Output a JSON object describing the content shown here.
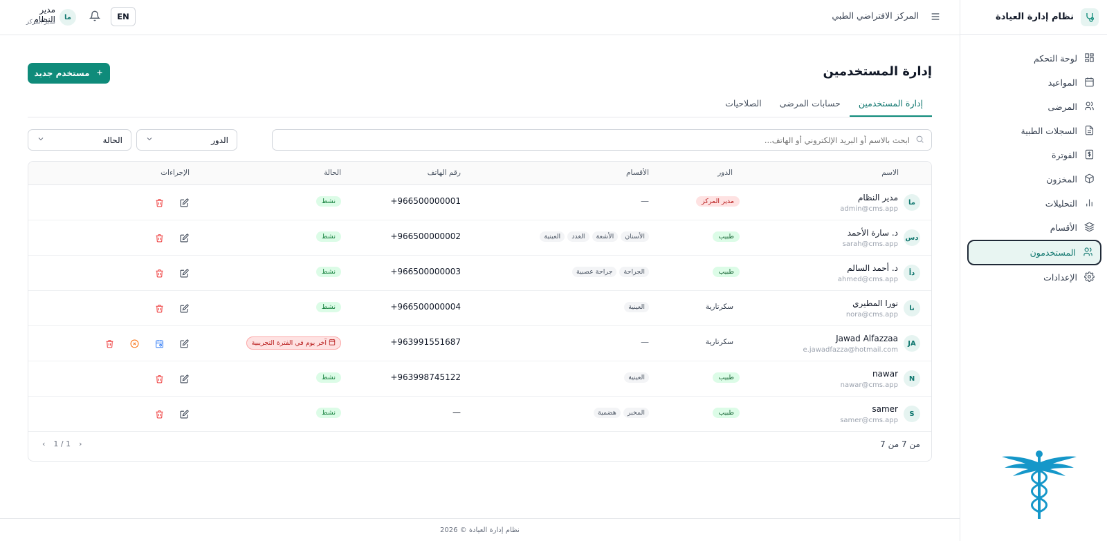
{
  "app": {
    "title": "نظام إدارة العيادة",
    "center_name": "المركز الافتراضي الطبي",
    "lang_button": "EN",
    "user": {
      "initials": "ما",
      "name": "مدير النظام",
      "role": "مدير المركز"
    },
    "footer": "نظام إدارة العيادة © 2026"
  },
  "sidebar": {
    "items": [
      {
        "label": "لوحة التحكم",
        "icon": "dashboard-icon"
      },
      {
        "label": "المواعيد",
        "icon": "calendar-icon"
      },
      {
        "label": "المرضى",
        "icon": "patients-icon"
      },
      {
        "label": "السجلات الطبية",
        "icon": "document-icon"
      },
      {
        "label": "الفوترة",
        "icon": "invoice-icon"
      },
      {
        "label": "المخزون",
        "icon": "box-icon"
      },
      {
        "label": "التحليلات",
        "icon": "chart-icon"
      },
      {
        "label": "الأقسام",
        "icon": "layers-icon"
      },
      {
        "label": "المستخدمون",
        "icon": "users-icon",
        "active": true
      },
      {
        "label": "الإعدادات",
        "icon": "gear-icon"
      }
    ]
  },
  "page": {
    "title": "إدارة المستخدمين",
    "new_button": "مستخدم جديد",
    "tabs": [
      "إدارة المستخدمين",
      "حسابات المرضى",
      "الصلاحيات"
    ],
    "search_placeholder": "ابحث بالاسم أو البريد الإلكتروني أو الهاتف...",
    "role_filter": "الدور",
    "status_filter": "الحالة"
  },
  "table": {
    "headers": {
      "name": "الاسم",
      "role": "الدور",
      "departments": "الأقسام",
      "phone": "رقم الهاتف",
      "status": "الحالة",
      "actions": "الإجراءات"
    },
    "rows": [
      {
        "initials": "ما",
        "name": "مدير النظام",
        "email": "admin@cms.app",
        "role": "مدير المركز",
        "role_style": "admin",
        "departments": [],
        "phone": "+966500000001",
        "status": "نشط"
      },
      {
        "initials": "دس",
        "name": "د. سارة الأحمد",
        "email": "sarah@cms.app",
        "role": "طبيب",
        "role_style": "doctor",
        "departments": [
          "الأسنان",
          "الأشعة",
          "الغدد",
          "العينية"
        ],
        "phone": "+966500000002",
        "status": "نشط"
      },
      {
        "initials": "دأ",
        "name": "د. أحمد السالم",
        "email": "ahmed@cms.app",
        "role": "طبيب",
        "role_style": "doctor",
        "departments": [
          "الجراحة",
          "جراحة عصبية"
        ],
        "phone": "+966500000003",
        "status": "نشط"
      },
      {
        "initials": "نا",
        "name": "نورا المطيري",
        "email": "nora@cms.app",
        "role": "سكرتارية",
        "role_style": "plain",
        "departments": [
          "العينية"
        ],
        "phone": "+966500000004",
        "status": "نشط"
      },
      {
        "initials": "JA",
        "name": "Jawad Alfazzaa",
        "email": "e.jawadfazza@hotmail.com",
        "role": "سكرتارية",
        "role_style": "plain",
        "departments": [],
        "phone": "+963991551687",
        "status": "آخر يوم في الفترة التجريبية",
        "trial": true
      },
      {
        "initials": "N",
        "name": "nawar",
        "email": "nawar@cms.app",
        "role": "طبيب",
        "role_style": "doctor",
        "departments": [
          "العينية"
        ],
        "phone": "+963998745122",
        "status": "نشط"
      },
      {
        "initials": "S",
        "name": "samer",
        "email": "samer@cms.app",
        "role": "طبيب",
        "role_style": "doctor",
        "departments": [
          "المخبر",
          "هضمية"
        ],
        "phone": "—",
        "status": "نشط"
      }
    ],
    "empty_dash": "—",
    "count_text": "من 7 من 7",
    "pager_text": "1 / 1"
  },
  "colors": {
    "accent": "#0f8b7a",
    "admin_badge_bg": "#fee2e2",
    "admin_badge_fg": "#b91c1c",
    "doctor_badge_bg": "#dcfce7",
    "doctor_badge_fg": "#166534"
  }
}
